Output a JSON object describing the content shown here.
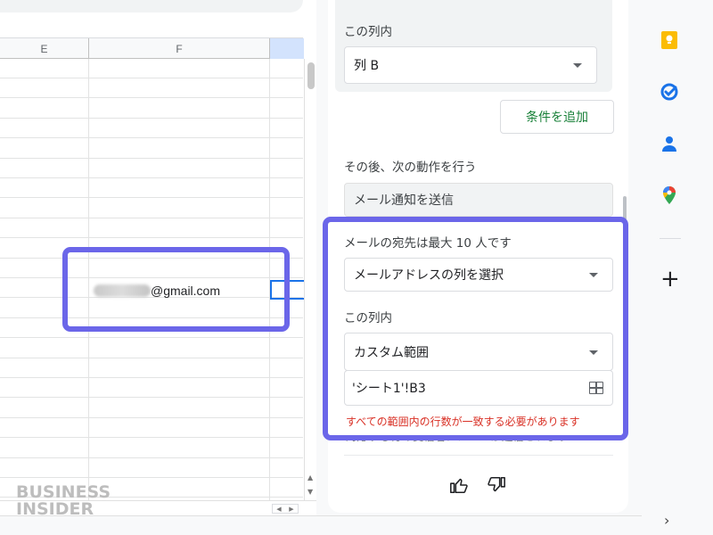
{
  "sheet": {
    "columns": [
      "E",
      "F"
    ],
    "email_suffix": "@gmail.com"
  },
  "panel": {
    "this_column_label": "この列内",
    "column_value": "列 B",
    "add_condition_button": "条件を追加",
    "then_label": "その後、次の動作を行う",
    "action_value": "メール通知を送信",
    "recipient_label": "メールの宛先は最大 10 人です",
    "email_column_select": "メールアドレスの列を選択",
    "this_column_label_2": "この列内",
    "range_select": "カスタム範囲",
    "range_input": "'シート1'!B3",
    "error_text": "すべての範囲内の行数が一致する必要があります",
    "cut_text": "対応する行の受信者にメールが送信されます"
  },
  "watermark": {
    "line1": "BUSINESS",
    "line2": "INSIDER"
  },
  "rail": {
    "icons": [
      "keep-icon",
      "tasks-icon",
      "contacts-icon",
      "maps-icon"
    ],
    "plus": "+",
    "chevron": "›"
  },
  "colors": {
    "highlight": "#6b66e9",
    "accent_green": "#188038",
    "error_red": "#d93025",
    "selection_blue": "#1a73e8"
  }
}
